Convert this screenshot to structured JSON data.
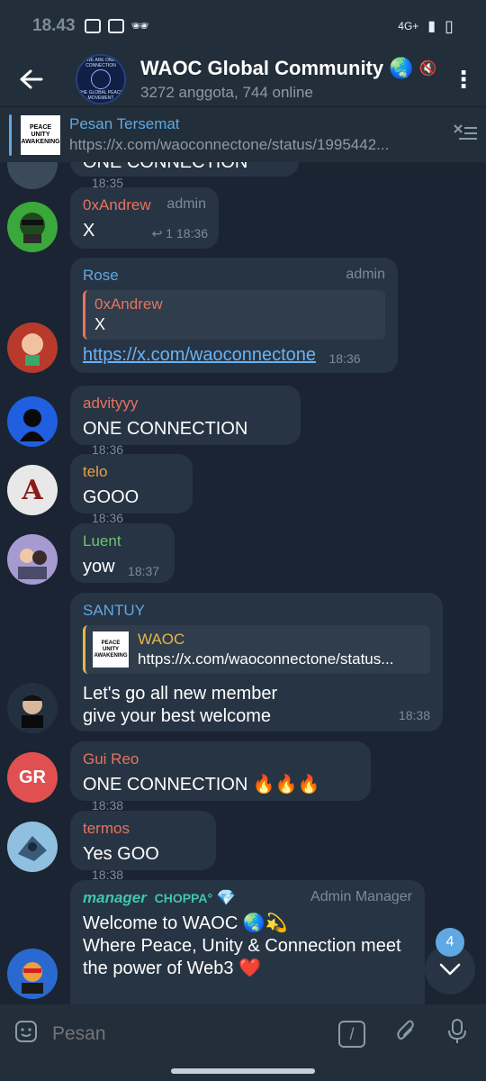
{
  "status_bar": {
    "time": "18.43",
    "network": "4G+"
  },
  "header": {
    "title": "WAOC Global Community",
    "title_emoji": "🌏",
    "subtitle": "3272 anggota, 744 online",
    "avatar_text": "WE ARE ONE CONNECTION",
    "avatar_sub": "THE GLOBAL PEACE MOVEMENT"
  },
  "pinned": {
    "label": "Pesan Tersemat",
    "url": "https://x.com/waoconnectone/status/1995442...",
    "thumb_text": "PEACE UNITY AWAKENING"
  },
  "messages": [
    {
      "sender": "",
      "text": "ONE CONNECTION",
      "time": "18:35"
    },
    {
      "sender": "0xAndrew",
      "role": "admin",
      "text": "X",
      "reply_count": "1",
      "time": "18:36",
      "name_color": "#e6745e"
    },
    {
      "sender": "Rose",
      "role": "admin",
      "reply_name": "0xAndrew",
      "reply_text": "X",
      "link": "https://x.com/waoconnectone",
      "time": "18:36",
      "name_color": "#5fa8e3"
    },
    {
      "sender": "advityyy",
      "text": "ONE CONNECTION",
      "time": "18:36",
      "name_color": "#e6745e"
    },
    {
      "sender": "telo",
      "text": "GOOO",
      "time": "18:36",
      "name_color": "#e8a04a"
    },
    {
      "sender": "Luent",
      "text": "yow",
      "time": "18:37",
      "name_color": "#6ec46e"
    },
    {
      "sender": "SANTUY",
      "preview_name": "WAOC",
      "preview_url": "https://x.com/waoconnectone/status...",
      "text_line1": "Let's go all new member",
      "text_line2": "give your best welcome",
      "time": "18:38",
      "name_color": "#5fa8e3"
    },
    {
      "sender": "Gui Reo",
      "avatar_initials": "GR",
      "text": "ONE CONNECTION 🔥🔥🔥",
      "time": "18:38",
      "name_color": "#e6745e"
    },
    {
      "sender": "termos",
      "text": "Yes GOO",
      "time": "18:38",
      "name_color": "#e6745e"
    },
    {
      "sender": "manager",
      "sender_suffix": "CHOPPA°",
      "role": "Admin Manager",
      "text_line1": "Welcome to WAOC 🌏💫",
      "text_line2": "Where Peace, Unity & Connection meet",
      "text_line3": "the power of Web3 ❤️",
      "name_color": "#3fc6b0"
    }
  ],
  "scroll_badge": "4",
  "input": {
    "placeholder": "Pesan"
  }
}
